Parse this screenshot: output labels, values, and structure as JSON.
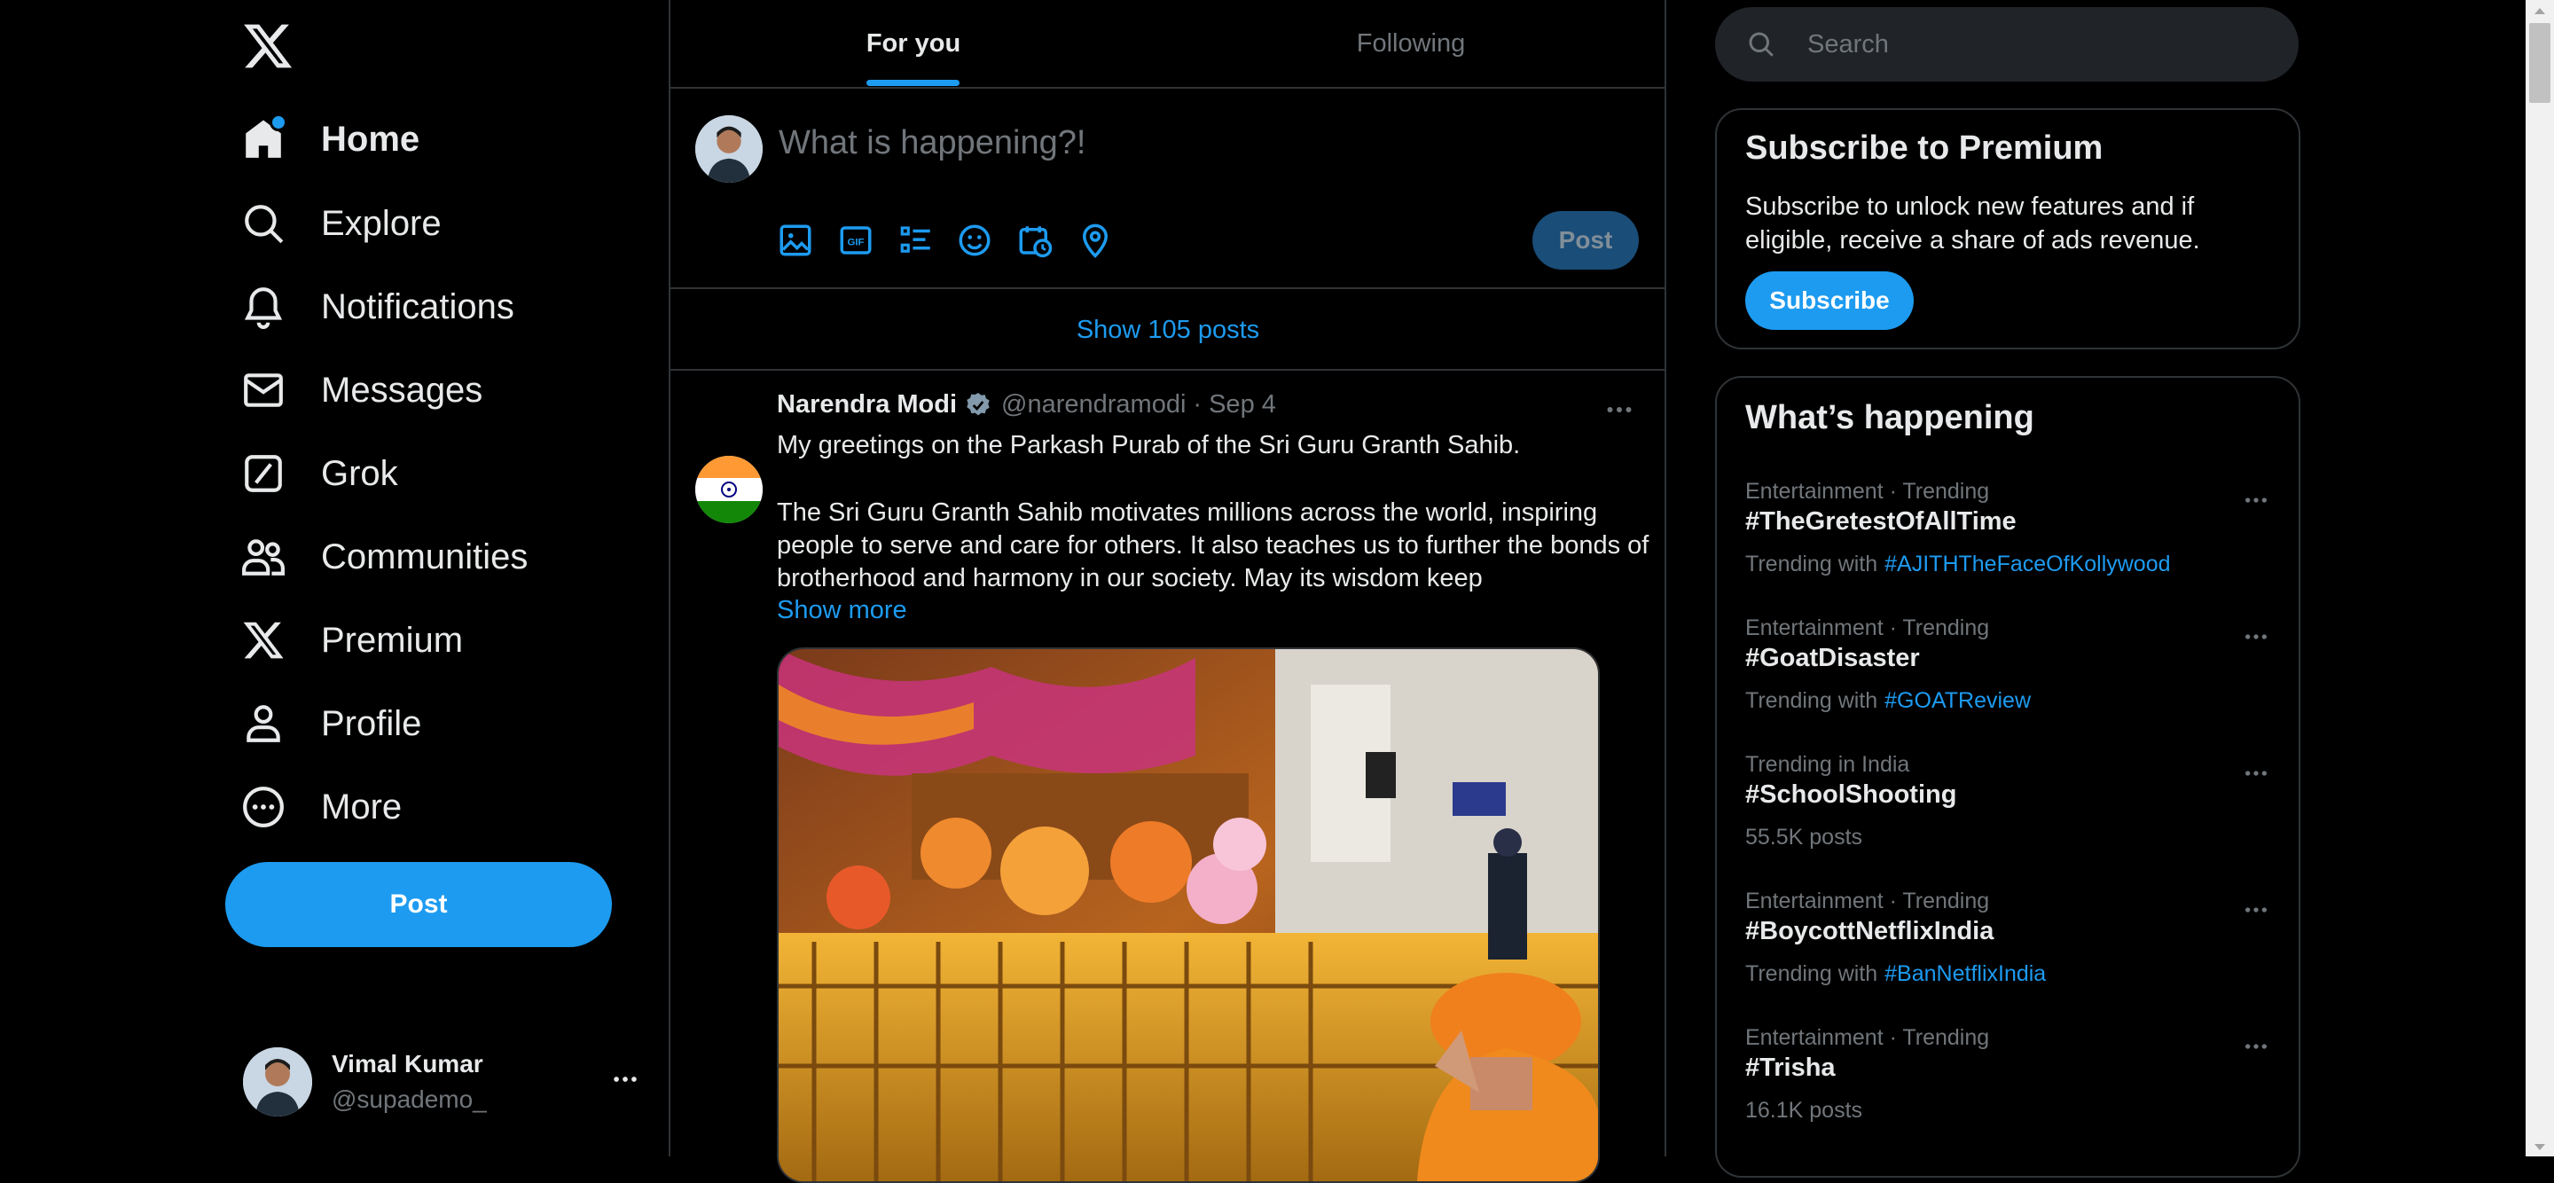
{
  "nav": {
    "items": [
      {
        "label": "Home",
        "icon": "home-icon"
      },
      {
        "label": "Explore",
        "icon": "search-icon"
      },
      {
        "label": "Notifications",
        "icon": "bell-icon"
      },
      {
        "label": "Messages",
        "icon": "mail-icon"
      },
      {
        "label": "Grok",
        "icon": "grok-icon"
      },
      {
        "label": "Communities",
        "icon": "people-icon"
      },
      {
        "label": "Premium",
        "icon": "x-logo-icon"
      },
      {
        "label": "Profile",
        "icon": "person-icon"
      },
      {
        "label": "More",
        "icon": "more-circle-icon"
      }
    ],
    "post_label": "Post"
  },
  "account": {
    "name": "Vimal Kumar",
    "handle": "@supademo_"
  },
  "tabs": {
    "for_you": "For you",
    "following": "Following"
  },
  "compose": {
    "placeholder": "What is happening?!",
    "post_label": "Post"
  },
  "feed": {
    "show_posts": "Show 105 posts"
  },
  "tweet": {
    "author": "Narendra Modi",
    "handle": "@narendramodi",
    "separator": "·",
    "date": "Sep 4",
    "lines": [
      "My greetings on the Parkash Purab of the Sri Guru Granth Sahib.",
      "The Sri Guru Granth Sahib motivates millions across the world, inspiring",
      "people to serve and care for others. It also teaches us to further the bonds of",
      "brotherhood and harmony in our society. May its wisdom keep"
    ],
    "show_more": "Show more"
  },
  "search": {
    "placeholder": "Search"
  },
  "premium": {
    "title": "Subscribe to Premium",
    "description": "Subscribe to unlock new features and if eligible, receive a share of ads revenue.",
    "button": "Subscribe"
  },
  "happening": {
    "title": "What’s happening",
    "trends": [
      {
        "context": "Entertainment · Trending",
        "tag": "#TheGretestOfAllTime",
        "sub": "Trending with",
        "link": "#AJITHTheFaceOfKollywood"
      },
      {
        "context": "Entertainment · Trending",
        "tag": "#GoatDisaster",
        "sub": "Trending with",
        "link": "#GOATReview"
      },
      {
        "context": "Trending in India",
        "tag": "#SchoolShooting",
        "sub": "55.5K posts",
        "link": ""
      },
      {
        "context": "Entertainment · Trending",
        "tag": "#BoycottNetflixIndia",
        "sub": "Trending with",
        "link": "#BanNetflixIndia"
      },
      {
        "context": "Entertainment · Trending",
        "tag": "#Trisha",
        "sub": "16.1K posts",
        "link": ""
      }
    ]
  },
  "colors": {
    "accent": "#1d9bf0",
    "background": "#000000",
    "border": "#2f3336",
    "muted": "#71767b",
    "text": "#e7e9ea"
  }
}
